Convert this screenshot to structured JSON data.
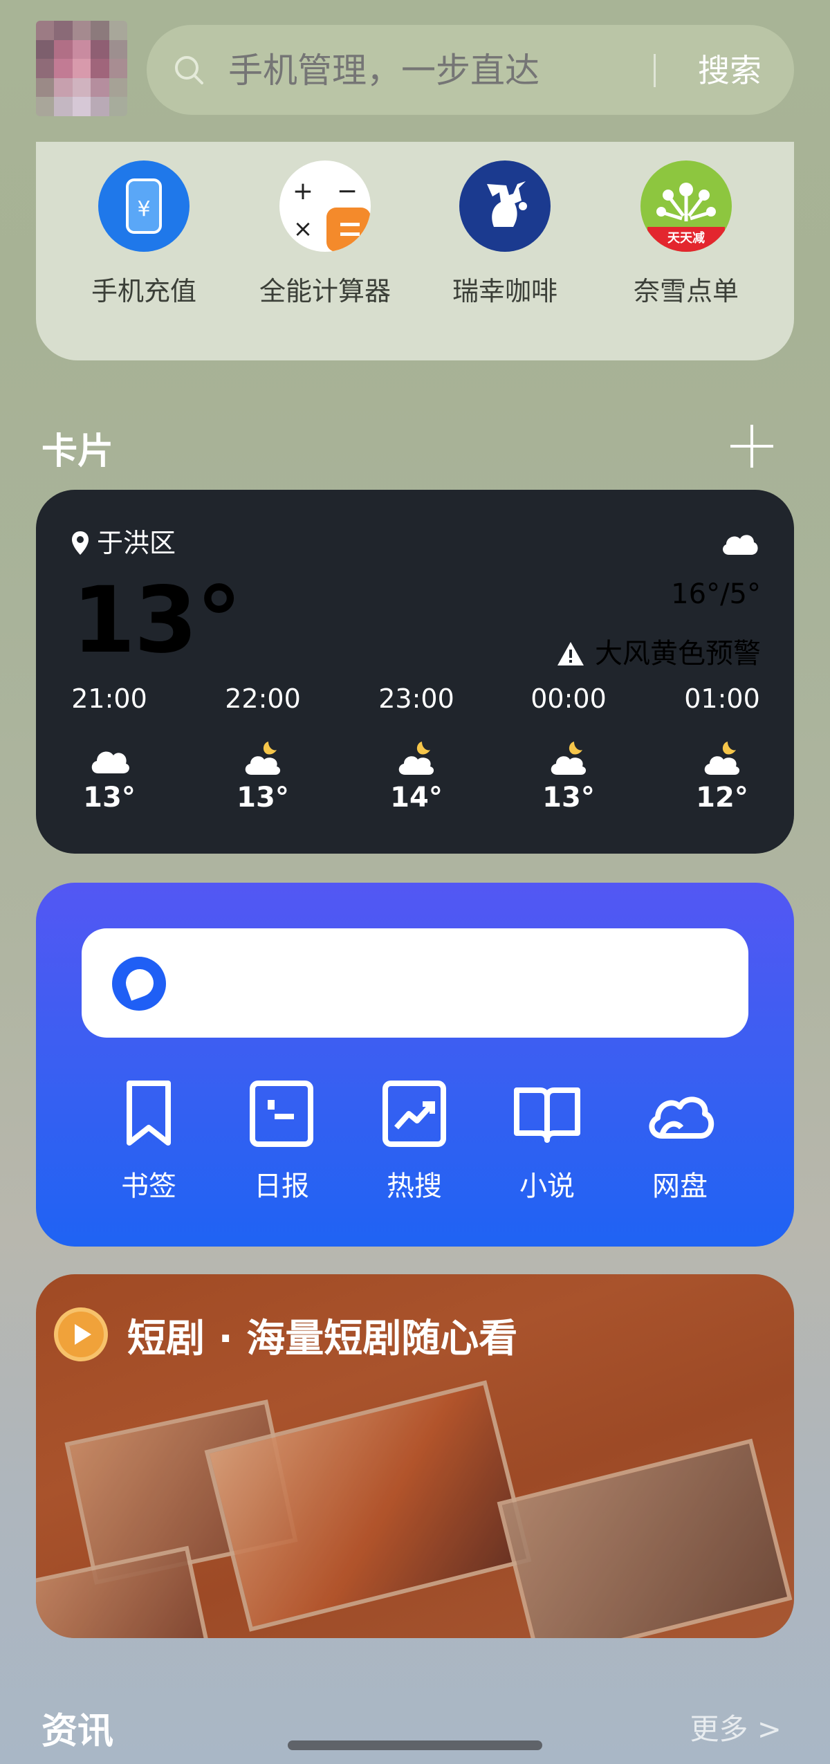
{
  "search": {
    "placeholder": "手机管理，一步直达",
    "button": "搜索"
  },
  "apps": [
    {
      "label": "手机充值",
      "icon": "phone-recharge-icon"
    },
    {
      "label": "全能计算器",
      "icon": "calculator-icon"
    },
    {
      "label": "瑞幸咖啡",
      "icon": "luckin-coffee-icon"
    },
    {
      "label": "奈雪点单",
      "icon": "nayuki-icon",
      "badge": "天天减"
    }
  ],
  "cards": {
    "title": "卡片"
  },
  "weather": {
    "location": "于洪区",
    "temperature": "13°",
    "range": "16°/5°",
    "alert": "大风黄色预警",
    "hours": [
      {
        "time": "21:00",
        "temp": "13°",
        "icon": "cloud-icon"
      },
      {
        "time": "22:00",
        "temp": "13°",
        "icon": "moon-cloud-icon"
      },
      {
        "time": "23:00",
        "temp": "14°",
        "icon": "moon-cloud-icon"
      },
      {
        "time": "00:00",
        "temp": "13°",
        "icon": "moon-cloud-icon"
      },
      {
        "time": "01:00",
        "temp": "12°",
        "icon": "moon-cloud-icon"
      }
    ]
  },
  "browser": {
    "tools": [
      {
        "label": "书签",
        "icon": "bookmark-icon"
      },
      {
        "label": "日报",
        "icon": "daily-report-icon"
      },
      {
        "label": "热搜",
        "icon": "trending-icon"
      },
      {
        "label": "小说",
        "icon": "book-icon"
      },
      {
        "label": "网盘",
        "icon": "cloud-drive-icon"
      }
    ]
  },
  "drama": {
    "title": "短剧 · 海量短剧随心看"
  },
  "news": {
    "title": "资讯",
    "more": "更多 >"
  }
}
